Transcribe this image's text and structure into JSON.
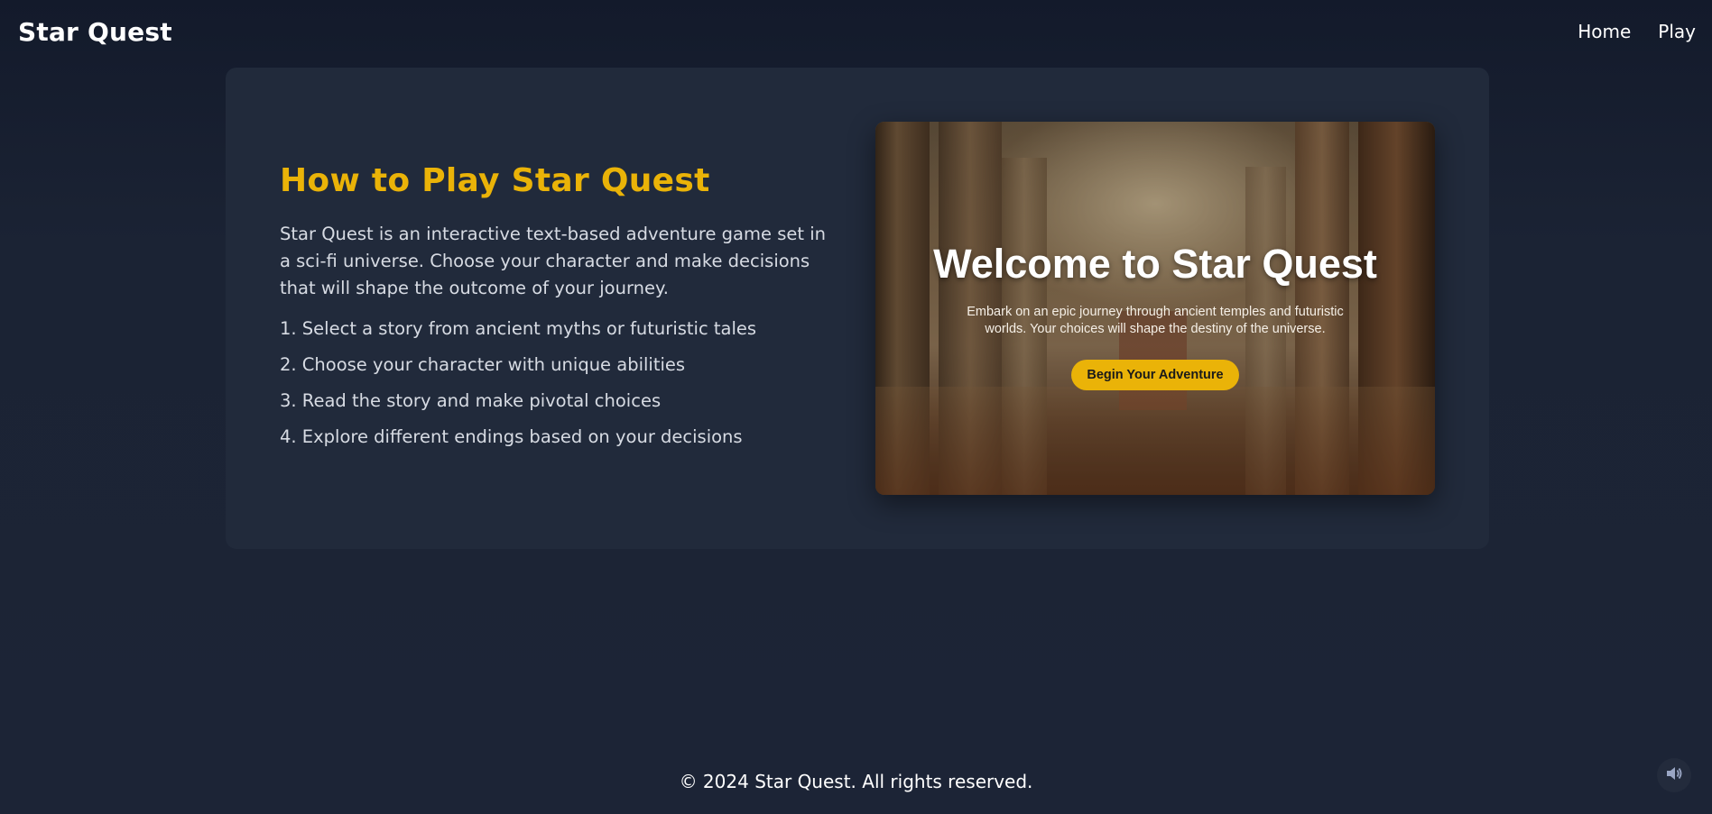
{
  "navbar": {
    "brand": "Star Quest",
    "links": [
      {
        "label": "Home"
      },
      {
        "label": "Play"
      }
    ]
  },
  "main": {
    "title": "How to Play Star Quest",
    "intro": "Star Quest is an interactive text-based adventure game set in a sci-fi universe. Choose your character and make decisions that will shape the outcome of your journey.",
    "steps": [
      "1. Select a story from ancient myths or futuristic tales",
      "2. Choose your character with unique abilities",
      "3. Read the story and make pivotal choices",
      "4. Explore different endings based on your decisions"
    ]
  },
  "hero": {
    "title": "Welcome to Star Quest",
    "subtitle": "Embark on an epic journey through ancient temples and futuristic worlds. Your choices will shape the destiny of the universe.",
    "cta_label": "Begin Your Adventure"
  },
  "footer": {
    "text": "© 2024 Star Quest. All rights reserved."
  },
  "icons": {
    "sound": "speaker-icon"
  },
  "colors": {
    "accent": "#eab308",
    "background": "#1b2334",
    "card": "#212a3b"
  }
}
